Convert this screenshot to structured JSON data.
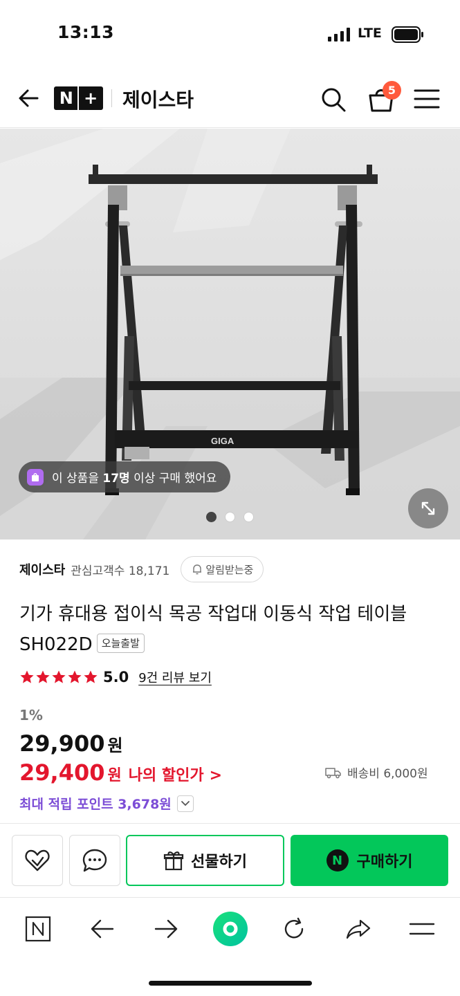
{
  "status_bar": {
    "time": "13:13",
    "network": "LTE"
  },
  "header": {
    "logo_n": "N",
    "logo_plus": "+",
    "store_title": "제이스타",
    "cart_count": "5"
  },
  "hero": {
    "purchase_notice_pre": "이 상품을 ",
    "purchase_notice_count": "17명",
    "purchase_notice_post": " 이상 구매 했어요",
    "brand_on_product": "GIGA",
    "pages": 3,
    "active_page": 1
  },
  "product": {
    "store_name": "제이스타",
    "interest_label": "관심고객수 18,171",
    "alarm_label": "알림받는중",
    "title": "기가 휴대용 접이식 목공 작업대 이동식 작업 테이블 SH022D",
    "badge": "오늘출발",
    "rating": "5.0",
    "rating_stars": 5,
    "review_link": "9건 리뷰 보기",
    "discount_rate": "1%",
    "original_price": "29,900",
    "price_unit": "원",
    "my_price": "29,400",
    "my_price_unit": "원",
    "my_price_label": "나의 할인가",
    "my_price_chevron": ">",
    "shipping": "배송비 6,000원",
    "points_label": "최대 적립 포인트 3,678원"
  },
  "action_bar": {
    "gift_label": "선물하기",
    "buy_label": "구매하기",
    "npay_letter": "N"
  },
  "colors": {
    "naver_green": "#03c75a",
    "price_red": "#e3162d",
    "points_purple": "#7c4dd6",
    "badge_orange": "#ff5a3c"
  }
}
